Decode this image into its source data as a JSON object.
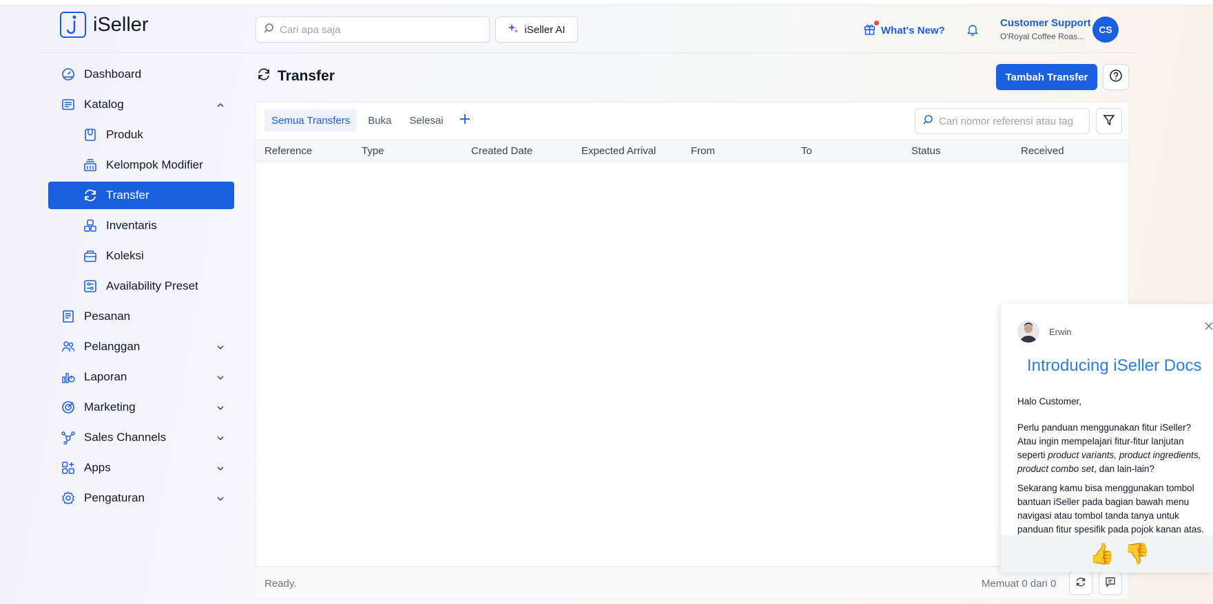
{
  "header": {
    "logo_text": "iSeller",
    "search_placeholder": "Cari apa saja",
    "ai_button": "iSeller AI",
    "whats_new": "What's New?",
    "user_name": "Customer Support",
    "store_name": "O'Royal Coffee Roas...",
    "avatar_initials": "CS"
  },
  "sidebar": {
    "items": [
      {
        "label": "Dashboard",
        "icon": "dashboard-icon"
      },
      {
        "label": "Katalog",
        "icon": "catalog-icon",
        "expanded": true
      },
      {
        "label": "Produk",
        "icon": "product-icon"
      },
      {
        "label": "Kelompok Modifier",
        "icon": "modifier-group-icon"
      },
      {
        "label": "Transfer",
        "icon": "transfer-icon",
        "active": true
      },
      {
        "label": "Inventaris",
        "icon": "inventory-icon"
      },
      {
        "label": "Koleksi",
        "icon": "collection-icon"
      },
      {
        "label": "Availability Preset",
        "icon": "availability-preset-icon"
      },
      {
        "label": "Pesanan",
        "icon": "orders-icon"
      },
      {
        "label": "Pelanggan",
        "icon": "customers-icon"
      },
      {
        "label": "Laporan",
        "icon": "reports-icon"
      },
      {
        "label": "Marketing",
        "icon": "marketing-icon"
      },
      {
        "label": "Sales Channels",
        "icon": "sales-channels-icon"
      },
      {
        "label": "Apps",
        "icon": "apps-icon"
      },
      {
        "label": "Pengaturan",
        "icon": "settings-icon"
      }
    ]
  },
  "page": {
    "title": "Transfer",
    "add_button": "Tambah Transfer"
  },
  "tabs": [
    "Semua Transfers",
    "Buka",
    "Selesai"
  ],
  "table": {
    "search_placeholder": "Cari nomor referensi atau tag",
    "columns": [
      "Reference",
      "Type",
      "Created Date",
      "Expected Arrival",
      "From",
      "To",
      "Status",
      "Received"
    ],
    "rows": []
  },
  "footer": {
    "status": "Ready.",
    "count": "Memuat 0 dari 0"
  },
  "chat": {
    "agent_name": "Erwin",
    "title": "Introducing iSeller Docs",
    "greeting": "Halo Customer,",
    "para1_a": "Perlu panduan menggunakan fitur iSeller? Atau ingin mempelajari fitur-fitur lanjutan seperti ",
    "para1_em": "product variants, product ingredients, product combo set",
    "para1_b": ", dan lain-lain?",
    "para2": "Sekarang kamu bisa menggunakan tombol bantuan iSeller pada bagian bawah menu navigasi atau tombol tanda tanya untuk panduan fitur spesifik pada pojok kanan atas.",
    "thumbs_up": "👍",
    "thumbs_down": "👎"
  },
  "colors": {
    "accent": "#1a5fe0",
    "chat_title": "#2a7ed8"
  }
}
